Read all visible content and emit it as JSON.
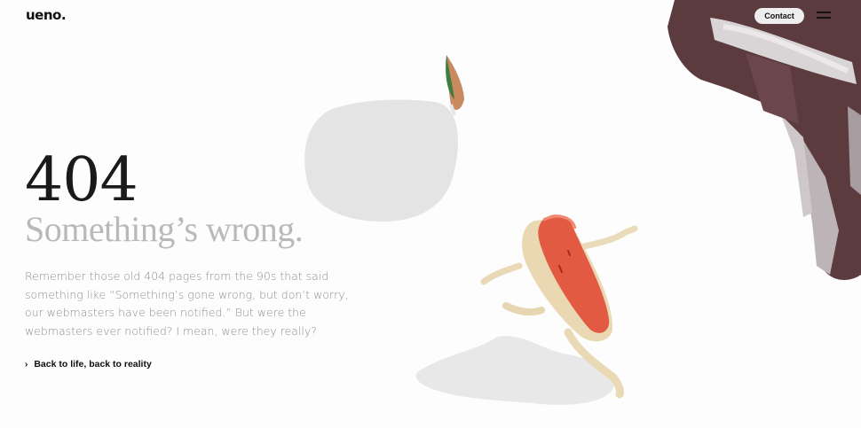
{
  "header": {
    "logo": "ueno.",
    "contact_label": "Contact",
    "menu_icon": "hamburger-icon"
  },
  "main": {
    "code": "404",
    "heading": "Something’s wrong.",
    "body": "Remember those old 404 pages from the 90s that said something like “Something’s gone wrong, but don’t worry, our webmasters have been notified.” But were the webmasters ever notified? I mean, were they really?",
    "back_link_label": "Back to life, back to reality",
    "back_link_icon": "chevron-right-icon"
  },
  "colors": {
    "text_dark": "#111111",
    "text_muted": "#8e8e8e",
    "heading_light": "#b9b9b9",
    "contact_bg": "#eeeeee"
  }
}
